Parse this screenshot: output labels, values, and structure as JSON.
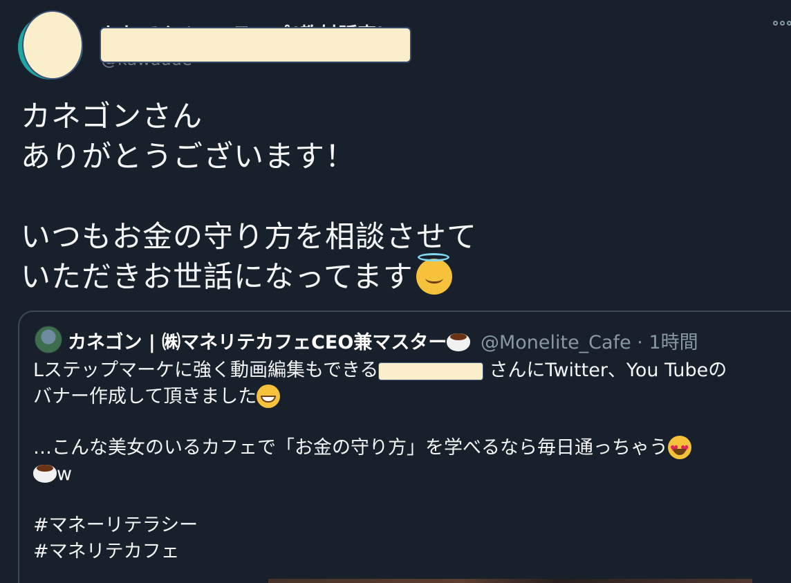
{
  "author": {
    "name_partial": "かわてん | Lステップ(教材販売)",
    "handle_partial": "@kawaude",
    "avatar_icon": "avatar-icon",
    "more_icon": "more-options-icon"
  },
  "tweet": {
    "lines": [
      "カネゴンさん",
      "ありがとうございます！",
      "",
      "いつもお金の守り方を相談させて",
      "いただきお世話になってます"
    ],
    "end_emoji": "smiling-face-with-halo"
  },
  "quoted_tweet": {
    "author_name": "カネゴン | ㈱マネリテカフェCEO兼マスター",
    "author_emoji": "coffee-icon",
    "handle": "@Monelite_Cafe",
    "separator": "·",
    "time": "1時間",
    "body": {
      "line1_before": "Lステップマーケに強く動画編集もできる",
      "line1_after": "さんにTwitter、You Tubeの",
      "line2": "バナー作成して頂きました",
      "line3": "…こんな美女のいるカフェで「お金の守り方」を学べるなら毎日通っちゃう",
      "line4": "w",
      "hashtag1": "#マネーリテラシー",
      "hashtag2": "#マネリテカフェ"
    }
  },
  "colors": {
    "background": "#18202c",
    "text": "#f4f6f8",
    "secondary_text": "#8899a6",
    "card_border": "#3c4a58",
    "redaction_fill": "#fbeecb"
  }
}
